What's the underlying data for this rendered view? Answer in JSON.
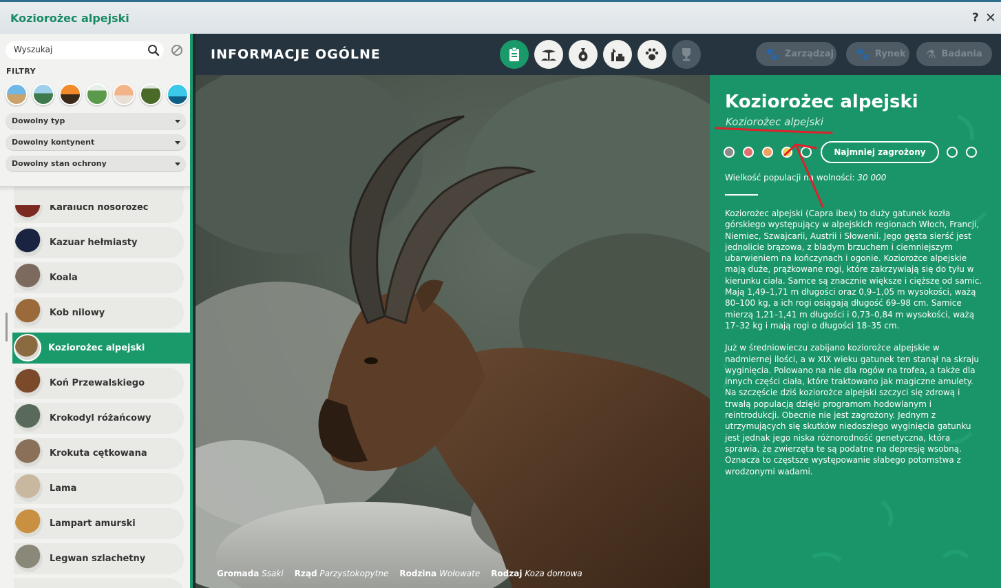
{
  "window": {
    "title": "Koziorożec alpejski",
    "help": "?",
    "close": "✕"
  },
  "sidebar": {
    "search": {
      "placeholder": "Wyszukaj"
    },
    "filters_label": "FILTRY",
    "biome_icons": [
      "grassland-icon",
      "taiga-icon",
      "desert-icon",
      "temperate-icon",
      "tundra-icon",
      "tropical-icon",
      "aquatic-icon"
    ],
    "dropdowns": [
      "Dowolny typ",
      "Dowolny kontynent",
      "Dowolny stan ochrony"
    ],
    "animals": [
      {
        "name": "Karaluch nosorożec",
        "color": "#7a2a20"
      },
      {
        "name": "Kazuar hełmiasty",
        "color": "#1a2440"
      },
      {
        "name": "Koala",
        "color": "#7d6a5e"
      },
      {
        "name": "Kob nilowy",
        "color": "#9a6a3a"
      },
      {
        "name": "Koziorożec alpejski",
        "color": "#8a6a40",
        "active": true
      },
      {
        "name": "Koń Przewalskiego",
        "color": "#7a4a2a"
      },
      {
        "name": "Krokodyl różańcowy",
        "color": "#5a6a5a"
      },
      {
        "name": "Krokuta cętkowana",
        "color": "#8a7058"
      },
      {
        "name": "Lama",
        "color": "#c8b8a0"
      },
      {
        "name": "Lampart amurski",
        "color": "#c89040"
      },
      {
        "name": "Legwan szlachetny",
        "color": "#8a8878"
      }
    ]
  },
  "header": {
    "title": "INFORMACJE OGÓLNE",
    "tabs": [
      {
        "icon": "clipboard-icon",
        "state": "active"
      },
      {
        "icon": "habitat-icon",
        "state": "normal"
      },
      {
        "icon": "food-sack-icon",
        "state": "normal"
      },
      {
        "icon": "enrichment-icon",
        "state": "normal"
      },
      {
        "icon": "paw-icon",
        "state": "normal"
      },
      {
        "icon": "trophy-icon",
        "state": "disabled"
      }
    ],
    "buttons": {
      "manage": "Zarządzaj",
      "market": "Rynek",
      "research": "Badania"
    }
  },
  "photo": {
    "taxonomy": [
      {
        "label": "Gromada",
        "value": "Ssaki"
      },
      {
        "label": "Rząd",
        "value": "Parzystokopytne"
      },
      {
        "label": "Rodzina",
        "value": "Wołowate"
      },
      {
        "label": "Rodzaj",
        "value": "Koza domowa"
      }
    ]
  },
  "info": {
    "name": "Koziorożec alpejski",
    "latin": "Koziorożec alpejski",
    "status_colors": [
      "#8a8a8a",
      "#e07070",
      "#f0a060",
      "#f0d050",
      "#1a9469",
      "#1a9469",
      "#1a9469"
    ],
    "status_label": "Najmniej zagrożony",
    "population_label": "Wielkość populacji na wolności:",
    "population_value": "30 000",
    "description": [
      "Koziorożec alpejski (Capra ibex) to duży gatunek kozła górskiego występujący w alpejskich regionach Włoch, Francji, Niemiec, Szwajcarii, Austrii i Słowenii. Jego gęsta sierść jest jednolicie brązowa, z bladym brzuchem i ciemniejszym ubarwieniem na kończynach i ogonie. Koziorożce alpejskie mają duże, prążkowane rogi, które zakrzywiają się do tyłu w kierunku ciała. Samce są znacznie większe i cięższe od samic. Mają 1,49–1,71 m długości oraz 0,9–1,05 m wysokości, ważą 80–100 kg, a ich rogi osiągają długość 69–98 cm. Samice mierzą 1,21–1,41 m długości i 0,73–0,84 m wysokości, ważą 17–32 kg i mają rogi o długości 18–35 cm.",
      "Już w średniowieczu zabijano koziorożce alpejskie w nadmiernej ilości, a w XIX wieku gatunek ten stanął na skraju wyginięcia. Polowano na nie dla rogów na trofea, a także dla innych części ciała, które traktowano jak magiczne amulety. Na szczęście dziś koziorożce alpejski szczyci się zdrową i trwałą populacją dzięki programom hodowlanym i reintrodukcji. Obecnie nie jest zagrożony. Jednym z utrzymujących się skutków niedoszłego wyginięcia gatunku jest jednak jego niska różnorodność genetyczna, która sprawia, że zwierzęta te są podatne na depresję wsobną. Oznacza to częstsze występowanie słabego potomstwa z wrodzonymi wadami."
    ]
  },
  "colors": {
    "accent": "#1a9a6a",
    "header": "#25343e",
    "annotation": "#e0202a"
  }
}
